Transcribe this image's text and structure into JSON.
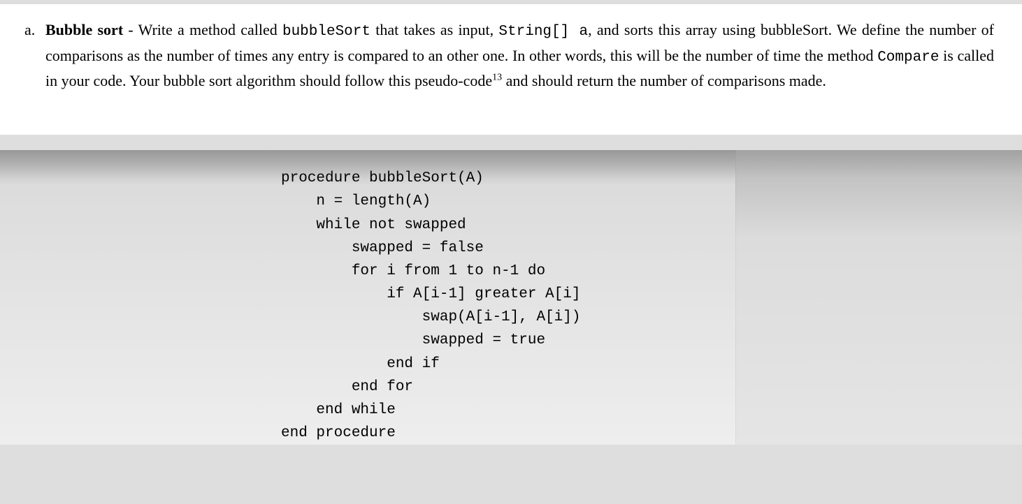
{
  "problem": {
    "label": "a.",
    "title": "Bubble sort",
    "dash": " - ",
    "text_1": "Write a method called ",
    "method_name": "bubbleSort",
    "text_2": " that takes as input, ",
    "param_type": "String[] a",
    "text_3": ", and sorts this array using bubbleSort.  We define the number of comparisons as the number of times any entry is compared to an other one.  In other words, this will be the number of time the method ",
    "compare_name": "Compare",
    "text_4": " is called in your code.  Your bubble sort algorithm should follow this pseudo-code",
    "footnote": "13",
    "text_5": " and should return the number of comparisons made."
  },
  "pseudocode": {
    "line1": "procedure bubbleSort(A)",
    "line2": "    n = length(A)",
    "line3": "    while not swapped",
    "line4": "        swapped = false",
    "line5": "        for i from 1 to n-1 do",
    "line6": "            if A[i-1] greater A[i]",
    "line7": "                swap(A[i-1], A[i])",
    "line8": "                swapped = true",
    "line9": "            end if",
    "line10": "        end for",
    "line11": "    end while",
    "line12": "end procedure"
  }
}
